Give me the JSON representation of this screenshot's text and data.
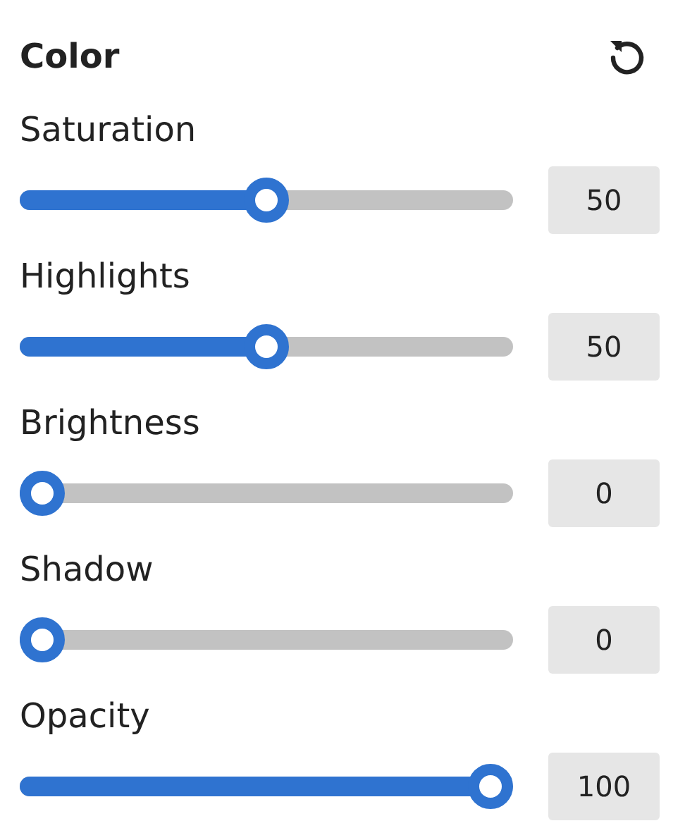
{
  "panel": {
    "title": "Color"
  },
  "sliders": [
    {
      "label": "Saturation",
      "level": 0.5,
      "value": "50"
    },
    {
      "label": "Highlights",
      "level": 0.5,
      "value": "50"
    },
    {
      "label": "Brightness",
      "level": 0,
      "value": "0"
    },
    {
      "label": "Shadow",
      "level": 0,
      "value": "0"
    },
    {
      "label": "Opacity",
      "level": 1,
      "value": "100"
    }
  ]
}
